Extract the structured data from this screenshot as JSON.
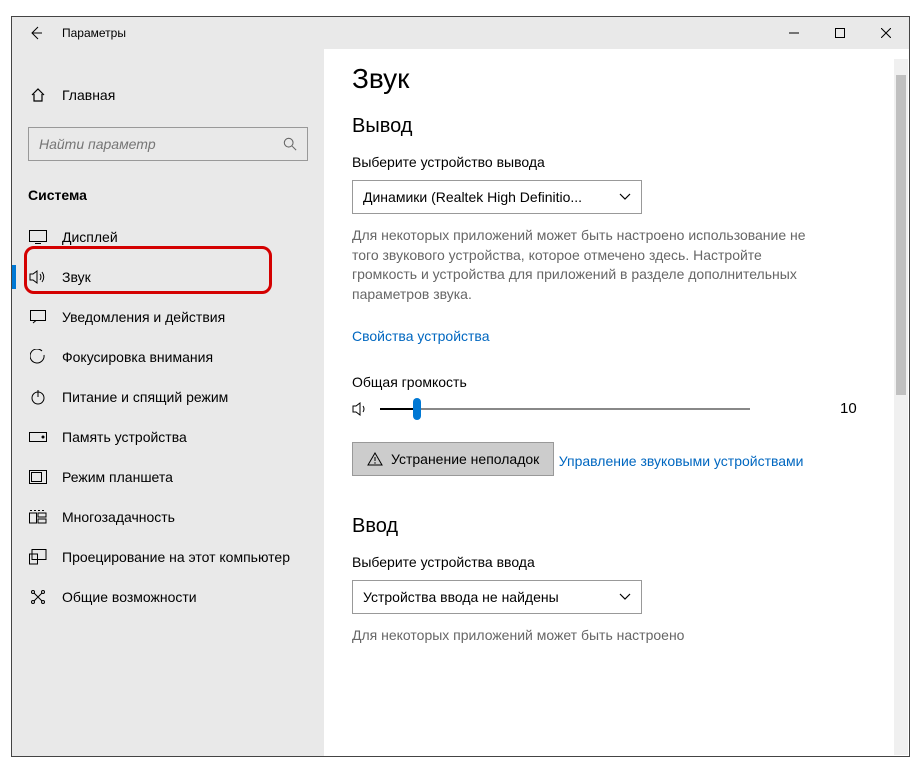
{
  "titlebar": {
    "title": "Параметры"
  },
  "sidebar": {
    "home": "Главная",
    "search_placeholder": "Найти параметр",
    "group": "Система",
    "items": [
      {
        "label": "Дисплей"
      },
      {
        "label": "Звук"
      },
      {
        "label": "Уведомления и действия"
      },
      {
        "label": "Фокусировка внимания"
      },
      {
        "label": "Питание и спящий режим"
      },
      {
        "label": "Память устройства"
      },
      {
        "label": "Режим планшета"
      },
      {
        "label": "Многозадачность"
      },
      {
        "label": "Проецирование на этот компьютер"
      },
      {
        "label": "Общие возможности"
      }
    ]
  },
  "content": {
    "title": "Звук",
    "output": {
      "heading": "Вывод",
      "select_label": "Выберите устройство вывода",
      "device": "Динамики (Realtek High Definitio...",
      "note": "Для некоторых приложений может быть настроено использование не того звукового устройства, которое отмечено здесь. Настройте громкость и устройства для приложений в разделе дополнительных параметров звука.",
      "properties_link": "Свойства устройства",
      "volume_label": "Общая громкость",
      "volume_value": "10",
      "volume_percent": 10,
      "troubleshoot": "Устранение неполадок",
      "manage_link": "Управление звуковыми устройствами"
    },
    "input": {
      "heading": "Ввод",
      "select_label": "Выберите устройства ввода",
      "device": "Устройства ввода не найдены",
      "note": "Для некоторых приложений может быть настроено"
    }
  }
}
